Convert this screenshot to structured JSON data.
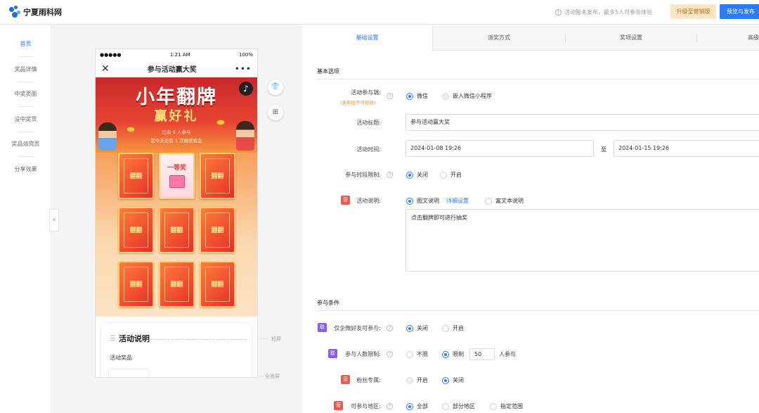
{
  "header": {
    "logo_text": "宁夏雨科网",
    "notice": "活动暂未发布，最多5人可参与体验",
    "upgrade_label": "升级至营销版",
    "publish_label": "预览与发布"
  },
  "sidebar": {
    "items": [
      {
        "label": "首页",
        "active": true
      },
      {
        "label": "奖品详情"
      },
      {
        "label": "中奖页面"
      },
      {
        "label": "没中奖页"
      },
      {
        "label": "奖品派完页"
      },
      {
        "label": "分享效果"
      }
    ],
    "collapse_glyph": "«"
  },
  "phone": {
    "carrier": "●●●●●",
    "time": "1:21 AM",
    "battery": "100%",
    "close_glyph": "✕",
    "title": "参与活动赢大奖",
    "more_glyph": "•••",
    "banner": {
      "title": "小年翻牌",
      "subtitle": "赢好礼",
      "info1": "已有 0 人参与",
      "info2": "您今天还有 1 次抽奖机会"
    },
    "cards": [
      {
        "label": "翻翻"
      },
      {
        "label": "一等奖",
        "open": true
      },
      {
        "label": "翻翻"
      },
      {
        "label": "翻翻"
      },
      {
        "label": "翻翻"
      },
      {
        "label": "翻翻"
      },
      {
        "label": "翻翻"
      },
      {
        "label": "翻翻"
      },
      {
        "label": "翻翻"
      }
    ],
    "intro_title": "活动说明",
    "intro_prize": "活动奖品"
  },
  "preview_labels": {
    "short_screen": "短屏",
    "full_screen": "全面屏"
  },
  "tabs": [
    {
      "label": "基础设置",
      "active": true
    },
    {
      "label": "派奖方式"
    },
    {
      "label": "奖项设置"
    },
    {
      "label": "高级"
    }
  ],
  "basic": {
    "section_title": "基本选项",
    "platform_label": "活动参与端:",
    "platform_note": "(发布后不可修改)",
    "platform_opt1": "微信",
    "platform_opt2": "嵌入微信小程序",
    "title_label": "活动标题:",
    "title_value": "参与活动赢大奖",
    "time_label": "活动时间:",
    "time_start": "2024-01-08 19:26",
    "time_to": "至",
    "time_end": "2024-01-15 19:26",
    "limit_label": "参与时段限制:",
    "limit_opt1": "关闭",
    "limit_opt2": "开启",
    "desc_badge": "营",
    "desc_label": "活动说明:",
    "desc_opt1": "图文说明",
    "desc_link": "详细设置",
    "desc_opt2": "富文本说明",
    "desc_text": "点击翻牌即可进行抽奖"
  },
  "conditions": {
    "section_title": "参与条件",
    "wecom_badge": "联",
    "wecom_label": "仅企微好友可参与:",
    "wecom_opt1": "关闭",
    "wecom_opt2": "开启",
    "people_badge": "联",
    "people_label": "参与人数限制:",
    "people_opt1": "不限",
    "people_opt2": "限制",
    "people_value": "50",
    "people_suffix": "人参与",
    "fans_badge": "营",
    "fans_label": "粉丝专属:",
    "fans_opt1": "开启",
    "fans_opt2": "关闭",
    "region_badge": "营",
    "region_label": "可参与地区:",
    "region_opt1": "全部",
    "region_opt2": "部分地区",
    "region_opt3": "指定范围"
  }
}
